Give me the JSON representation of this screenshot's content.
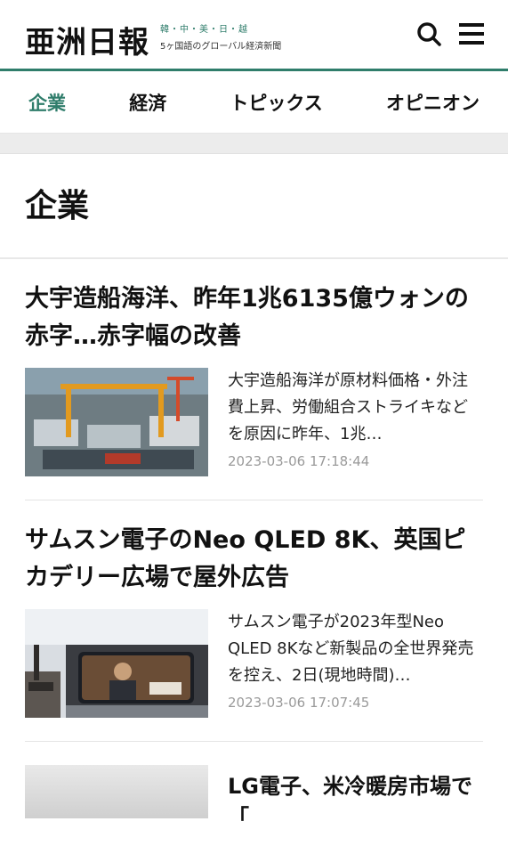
{
  "header": {
    "logo": "亜洲日報",
    "tagline_top": "韓・中・美・日・越",
    "tagline_bottom": "5ヶ国語のグローバル経済新聞",
    "search_icon": "search-icon",
    "menu_icon": "hamburger-menu-icon",
    "accent_color": "#2f7d6b"
  },
  "nav": {
    "items": [
      {
        "label": "企業",
        "active": true
      },
      {
        "label": "経済",
        "active": false
      },
      {
        "label": "トピックス",
        "active": false
      },
      {
        "label": "オピニオン",
        "active": false
      }
    ]
  },
  "section": {
    "title": "企業"
  },
  "articles": [
    {
      "headline": "大宇造船海洋、昨年1兆6135億ウォンの赤字…赤字幅の改善",
      "summary": "大宇造船海洋が原材料価格・外注費上昇、労働組合ストライキなどを原因に昨年、1兆…",
      "date": "2023-03-06 17:18:44"
    },
    {
      "headline": "サムスン電子のNeo QLED 8K、英国ピカデリー広場で屋外広告",
      "summary": "サムスン電子が2023年型Neo QLED 8Kなど新製品の全世界発売を控え、2日(現地時間)…",
      "date": "2023-03-06 17:07:45"
    },
    {
      "headline": "LG電子、米冷暖房市場で「"
    }
  ]
}
